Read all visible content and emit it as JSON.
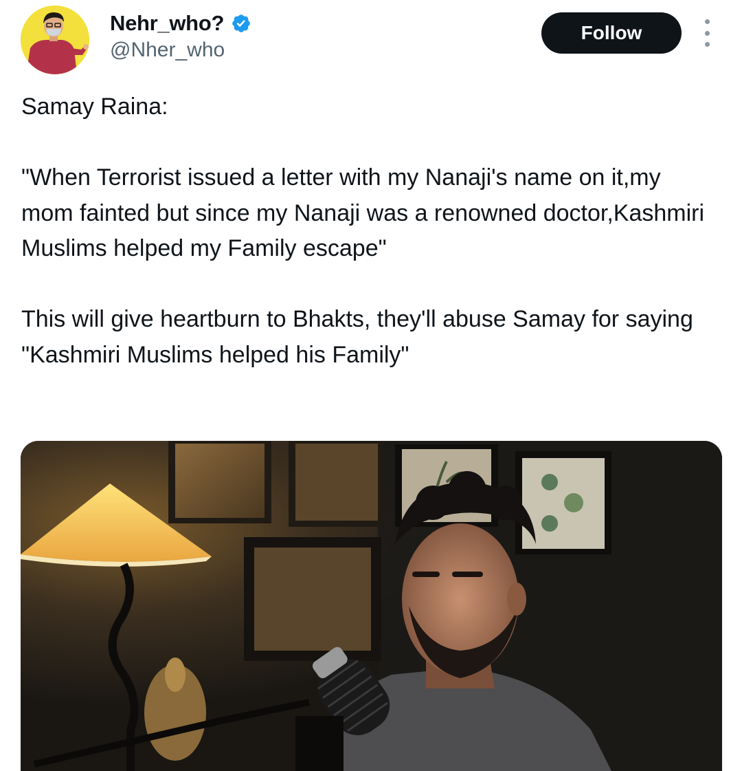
{
  "author": {
    "display_name": "Nehr_who?",
    "handle": "@Nher_who",
    "verified": true,
    "avatar_icon": "profile-avatar"
  },
  "actions": {
    "follow_label": "Follow",
    "more_icon": "more-vertical-icon"
  },
  "tweet": {
    "paragraphs": [
      "Samay Raina:",
      "\"When Terrorist issued a letter with my Nanaji's name on it,my mom fainted but since my Nanaji was a renowned doctor,Kashmiri Muslims helped my Family escape\"",
      "This will give heartburn to Bhakts, they'll abuse Samay for saying \"Kashmiri Muslims helped his Family\""
    ]
  },
  "media": {
    "type": "photo"
  },
  "colors": {
    "follow_bg": "#0f1419",
    "verified_blue": "#1d9bf0",
    "handle_gray": "#536471"
  }
}
